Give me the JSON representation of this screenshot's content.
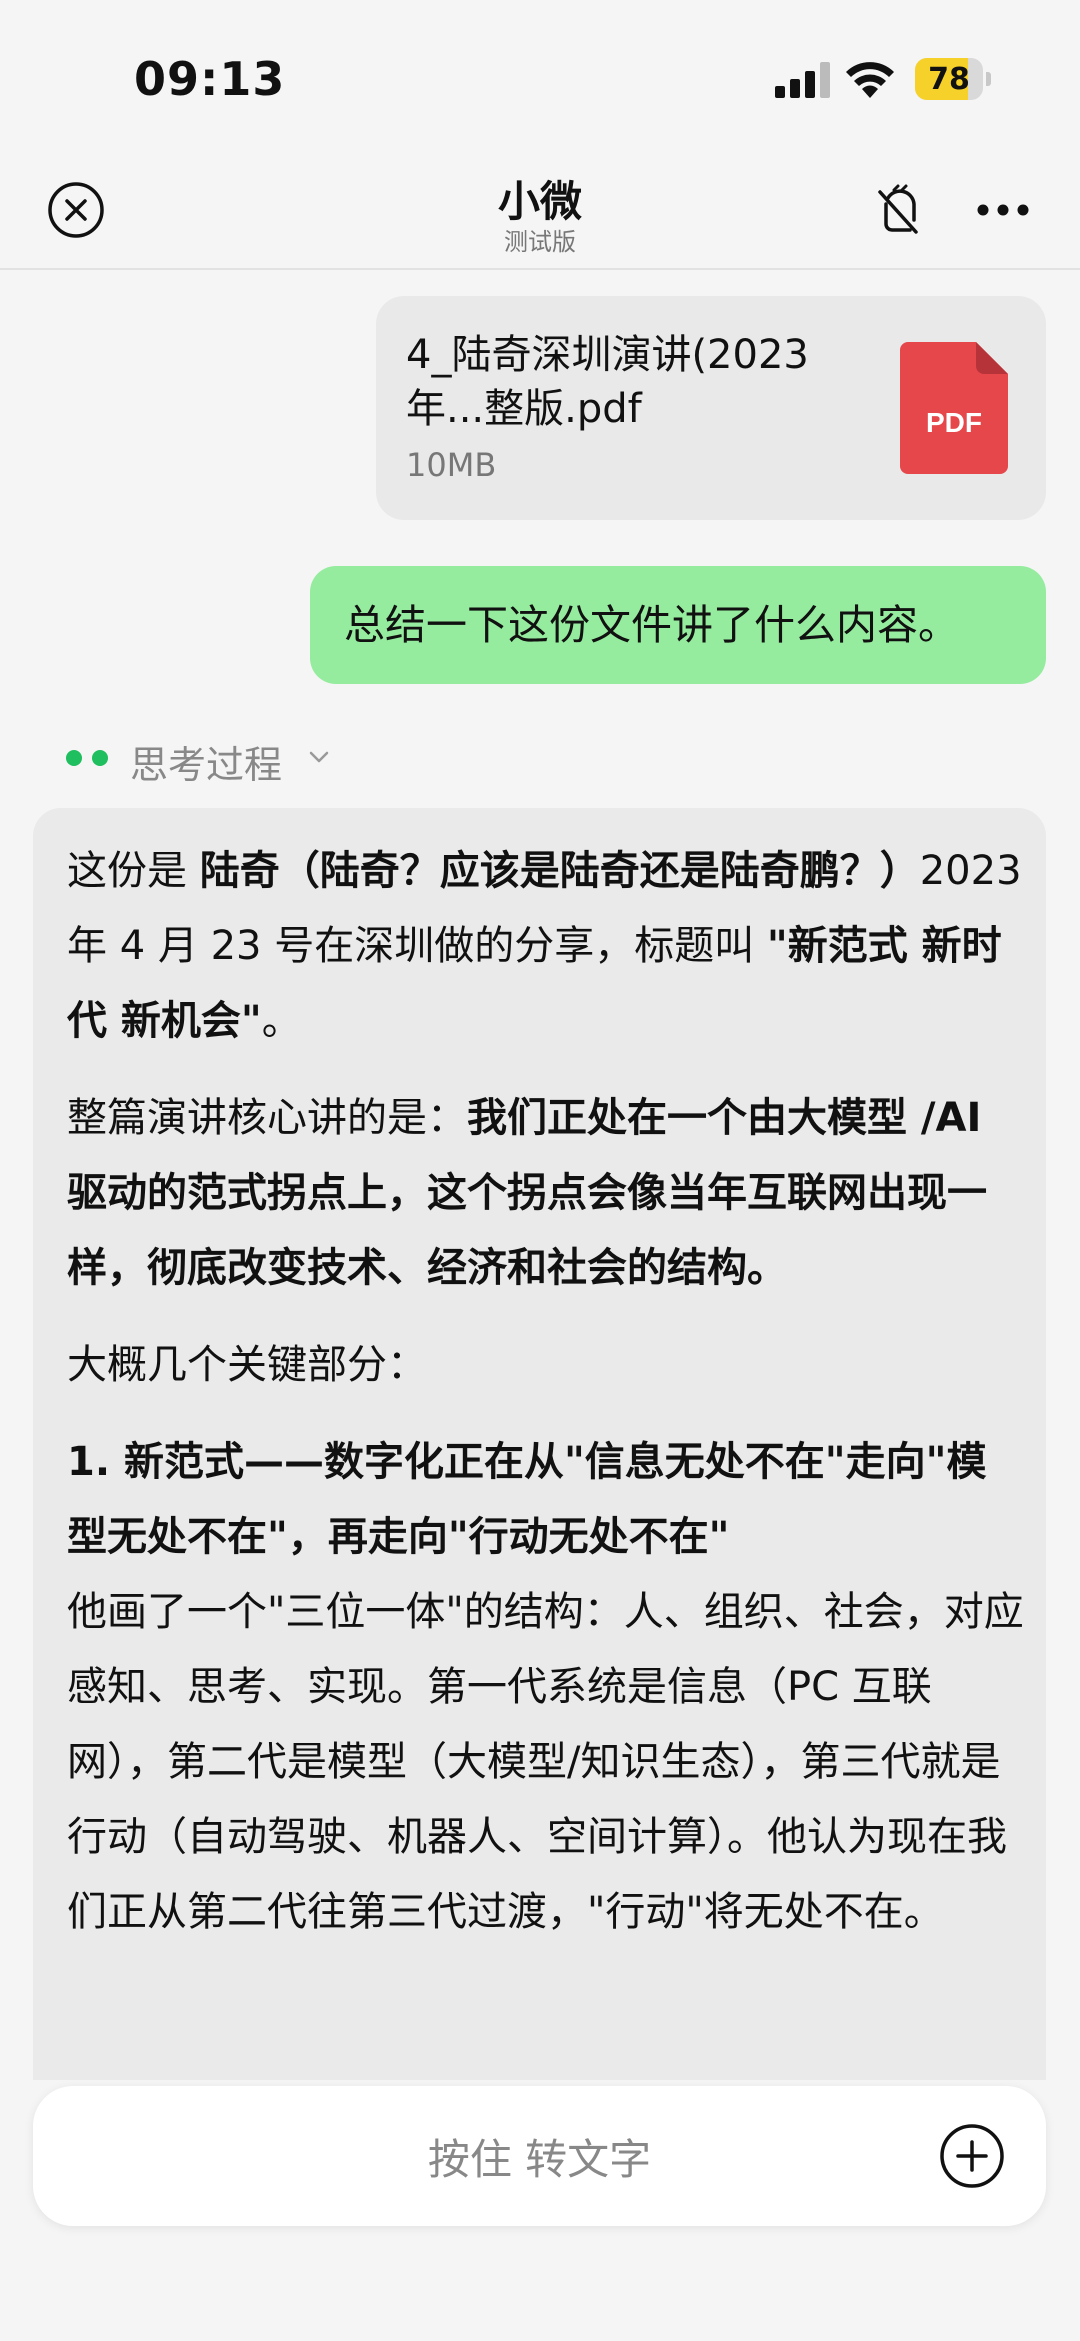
{
  "status_bar": {
    "time": "09:13",
    "battery": "78",
    "battery_level": 0.78
  },
  "nav": {
    "title": "小微",
    "subtitle": "测试版"
  },
  "file": {
    "name": "4_陆奇深圳演讲(2023年...整版.pdf",
    "size": "10MB",
    "icon_label": "PDF"
  },
  "user_message": "总结一下这份文件讲了什么内容。",
  "thinking": {
    "label": "思考过程"
  },
  "answer": {
    "p1_a": "这份是 ",
    "p1_b": "陆奇（陆奇？应该是陆奇还是陆奇鹏？）",
    "p1_c": "2023 年 4 月 23 号在深圳做的分享，标题叫 ",
    "p1_d": "\"新范式 新时代 新机会\"",
    "p1_e": "。",
    "p2_a": "整篇演讲核心讲的是：",
    "p2_b": "我们正处在一个由大模型 /AI 驱动的范式拐点上，这个拐点会像当年互联网出现一样，彻底改变技术、经济和社会的结构。",
    "p3": "大概几个关键部分：",
    "h1": "1. 新范式——数字化正在从\"信息无处不在\"走向\"模型无处不在\"，再走向\"行动无处不在\"",
    "p4": "他画了一个\"三位一体\"的结构：人、组织、社会，对应感知、思考、实现。第一代系统是信息（PC 互联网），第二代是模型（大模型/知识生态），第三代就是行动（自动驾驶、机器人、空间计算）。他认为现在我们正从第二代往第三代过渡，\"行动\"将无处不在。"
  },
  "input": {
    "label": "按住 转文字"
  }
}
